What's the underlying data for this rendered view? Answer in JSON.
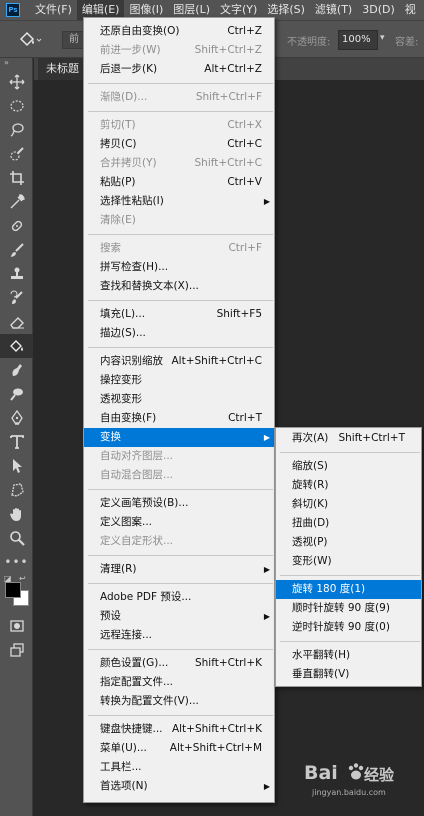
{
  "menubar": {
    "logo": "Ps",
    "items": [
      "文件(F)",
      "编辑(E)",
      "图像(I)",
      "图层(L)",
      "文字(Y)",
      "选择(S)",
      "滤镜(T)",
      "3D(D)",
      "视"
    ]
  },
  "options_bar": {
    "mode_field": "前",
    "opacity_label": "不透明度:",
    "opacity_value": "100%",
    "tolerance_label": "容差:"
  },
  "document": {
    "tab_label": "未标题"
  },
  "edit_menu": {
    "undo": {
      "label": "还原自由变换(O)",
      "shortcut": "Ctrl+Z"
    },
    "step_forward": {
      "label": "前进一步(W)",
      "shortcut": "Shift+Ctrl+Z"
    },
    "step_backward": {
      "label": "后退一步(K)",
      "shortcut": "Alt+Ctrl+Z"
    },
    "fade": {
      "label": "渐隐(D)...",
      "shortcut": "Shift+Ctrl+F"
    },
    "cut": {
      "label": "剪切(T)",
      "shortcut": "Ctrl+X"
    },
    "copy": {
      "label": "拷贝(C)",
      "shortcut": "Ctrl+C"
    },
    "copy_merged": {
      "label": "合并拷贝(Y)",
      "shortcut": "Shift+Ctrl+C"
    },
    "paste": {
      "label": "粘贴(P)",
      "shortcut": "Ctrl+V"
    },
    "paste_special": {
      "label": "选择性粘贴(I)"
    },
    "clear": {
      "label": "清除(E)"
    },
    "search": {
      "label": "搜索",
      "shortcut": "Ctrl+F"
    },
    "check_spelling": {
      "label": "拼写检查(H)..."
    },
    "find_replace": {
      "label": "查找和替换文本(X)..."
    },
    "fill": {
      "label": "填充(L)...",
      "shortcut": "Shift+F5"
    },
    "stroke": {
      "label": "描边(S)..."
    },
    "content_aware_scale": {
      "label": "内容识别缩放",
      "shortcut": "Alt+Shift+Ctrl+C"
    },
    "puppet_warp": {
      "label": "操控变形"
    },
    "perspective_warp": {
      "label": "透视变形"
    },
    "free_transform": {
      "label": "自由变换(F)",
      "shortcut": "Ctrl+T"
    },
    "transform": {
      "label": "变换"
    },
    "auto_align": {
      "label": "自动对齐图层..."
    },
    "auto_blend": {
      "label": "自动混合图层..."
    },
    "define_brush": {
      "label": "定义画笔预设(B)..."
    },
    "define_pattern": {
      "label": "定义图案..."
    },
    "define_shape": {
      "label": "定义自定形状..."
    },
    "purge": {
      "label": "清理(R)"
    },
    "pdf_presets": {
      "label": "Adobe PDF 预设..."
    },
    "presets": {
      "label": "预设"
    },
    "remote_connections": {
      "label": "远程连接..."
    },
    "color_settings": {
      "label": "颜色设置(G)...",
      "shortcut": "Shift+Ctrl+K"
    },
    "assign_profile": {
      "label": "指定配置文件..."
    },
    "convert_profile": {
      "label": "转换为配置文件(V)..."
    },
    "keyboard_shortcuts": {
      "label": "键盘快捷键...",
      "shortcut": "Alt+Shift+Ctrl+K"
    },
    "menus": {
      "label": "菜单(U)...",
      "shortcut": "Alt+Shift+Ctrl+M"
    },
    "toolbar": {
      "label": "工具栏..."
    },
    "preferences": {
      "label": "首选项(N)"
    }
  },
  "transform_submenu": {
    "again": {
      "label": "再次(A)",
      "shortcut": "Shift+Ctrl+T"
    },
    "scale": {
      "label": "缩放(S)"
    },
    "rotate": {
      "label": "旋转(R)"
    },
    "skew": {
      "label": "斜切(K)"
    },
    "distort": {
      "label": "扭曲(D)"
    },
    "perspective": {
      "label": "透视(P)"
    },
    "warp": {
      "label": "变形(W)"
    },
    "rotate_180": {
      "label": "旋转 180 度(1)"
    },
    "rotate_cw": {
      "label": "顺时针旋转 90 度(9)"
    },
    "rotate_ccw": {
      "label": "逆时针旋转 90 度(0)"
    },
    "flip_horizontal": {
      "label": "水平翻转(H)"
    },
    "flip_vertical": {
      "label": "垂直翻转(V)"
    }
  },
  "watermark": {
    "brand": "Bai",
    "brand_cn": "经验",
    "url": "jingyan.baidu.com"
  },
  "colors": {
    "highlight": "#0078d7",
    "menu_bg": "#f0f0f0",
    "chrome": "#535353"
  }
}
